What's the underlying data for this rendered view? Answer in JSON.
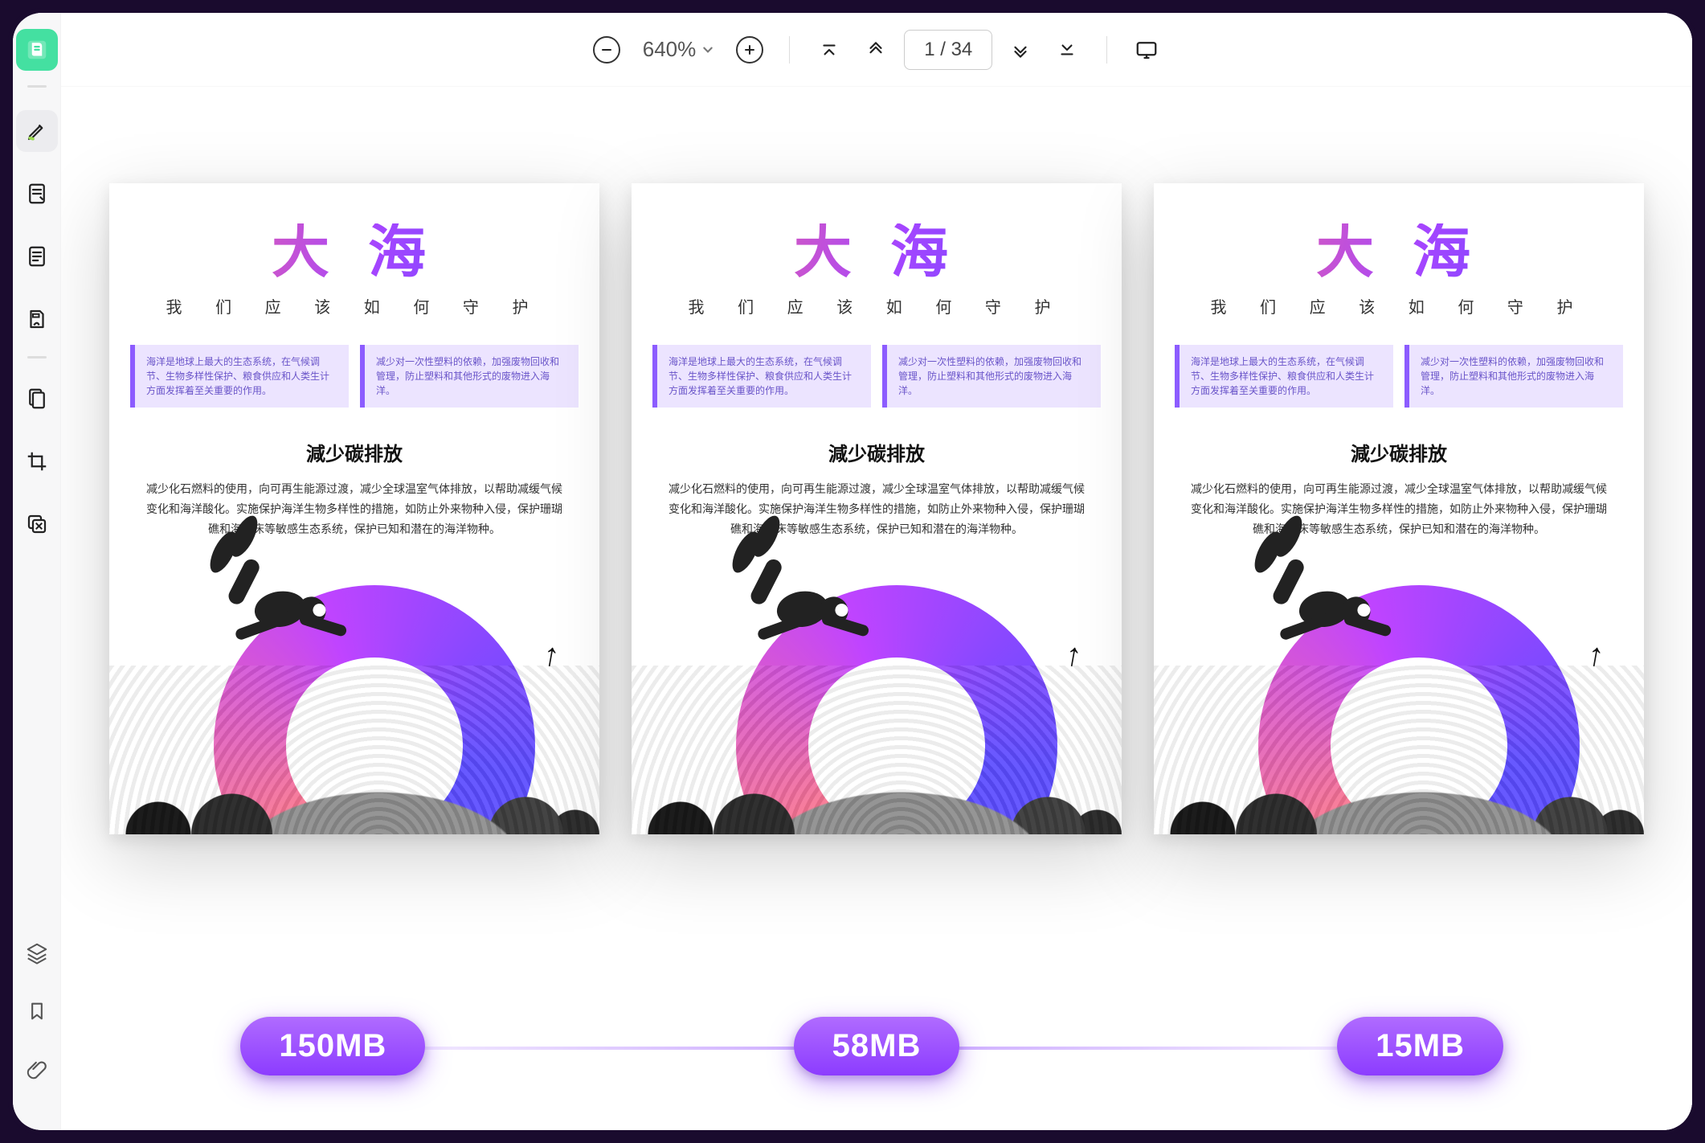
{
  "toolbar": {
    "zoom": "640%",
    "page_display": "1 / 34"
  },
  "sidebar": {
    "items": [
      {
        "name": "logo",
        "icon": "logo"
      },
      {
        "name": "highlighter",
        "icon": "highlighter"
      },
      {
        "name": "notes",
        "icon": "notes"
      },
      {
        "name": "outline",
        "icon": "outline"
      },
      {
        "name": "fill-sign",
        "icon": "fill-sign"
      },
      {
        "name": "page-edit",
        "icon": "page-edit"
      },
      {
        "name": "crop",
        "icon": "crop"
      },
      {
        "name": "stack",
        "icon": "stack"
      }
    ],
    "bottom": [
      {
        "name": "layers",
        "icon": "layers"
      },
      {
        "name": "bookmark",
        "icon": "bookmark"
      },
      {
        "name": "attachment",
        "icon": "attachment"
      }
    ]
  },
  "document": {
    "title": "大 海",
    "subtitle": "我 们 应 该 如 何 守 护",
    "box1": "海洋是地球上最大的生态系统，在气候调节、生物多样性保护、粮食供应和人类生计方面发挥着至关重要的作用。",
    "box2": "减少对一次性塑料的依赖，加强废物回收和管理，防止塑料和其他形式的废物进入海洋。",
    "section_heading": "減少碳排放",
    "paragraph": "减少化石燃料的使用，向可再生能源过渡，减少全球温室气体排放，以帮助减缓气候变化和海洋酸化。实施保护海洋生物多样性的措施，如防止外来物种入侵，保护珊瑚礁和海草床等敏感生态系统，保护已知和潜在的海洋物种。"
  },
  "comparison": {
    "sizes": [
      "150MB",
      "58MB",
      "15MB"
    ]
  }
}
